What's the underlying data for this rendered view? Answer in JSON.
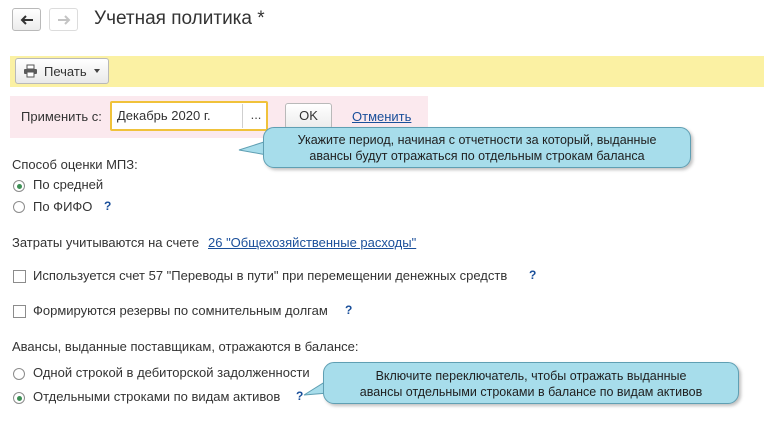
{
  "header": {
    "title": "Учетная политика *"
  },
  "toolbar": {
    "print_label": "Печать"
  },
  "apply": {
    "label": "Применить с:",
    "period_value": "Декабрь 2020 г.",
    "dots": "...",
    "ok_label": "OK",
    "cancel_label": "Отменить"
  },
  "tooltip_period": {
    "line1": "Укажите период, начиная с отчетности за который, выданные",
    "line2": "авансы будут отражаться по отдельным строкам баланса"
  },
  "mpz": {
    "label": "Способ оценки МПЗ:",
    "options": [
      "По средней",
      "По ФИФО"
    ],
    "selected": "По средней"
  },
  "costs": {
    "text": "Затраты учитываются на счете",
    "link": "26 \"Общехозяйственные расходы\""
  },
  "checkboxes": [
    {
      "label": "Используется счет 57 \"Переводы в пути\" при перемещении денежных средств",
      "checked": false
    },
    {
      "label": "Формируются резервы по сомнительным долгам",
      "checked": false
    }
  ],
  "advances": {
    "label": "Авансы, выданные поставщикам, отражаются в балансе:",
    "options": [
      "Одной строкой в дебиторской задолженности",
      "Отдельными строками по видам активов"
    ],
    "selected": "Отдельными строками по видам активов"
  },
  "tooltip_switch": {
    "line1": "Включите переключатель, чтобы отражать выданные",
    "line2": "авансы отдельными строками в балансе по видам активов"
  },
  "help_mark": "?",
  "colors": {
    "toolbar_bg": "#fbf1a3",
    "apply_panel_bg": "#fbe9ee",
    "focus_border": "#f0c23a",
    "tooltip_bg": "#a7ddeb",
    "link": "#1a4f9a",
    "radio_on": "#3d8f55"
  }
}
